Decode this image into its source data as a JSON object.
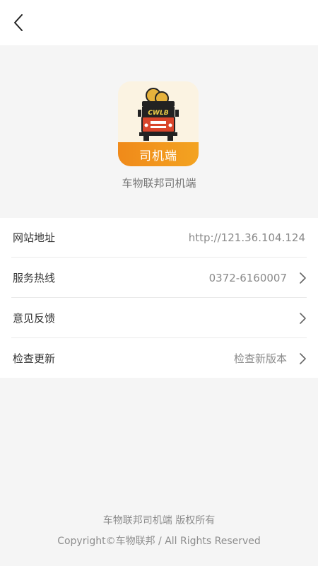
{
  "app": {
    "icon_label": "司机端",
    "icon_logo_text": "CWLB",
    "name": "车物联邦司机端"
  },
  "settings": [
    {
      "label": "网站地址",
      "value": "http://121.36.104.124"
    },
    {
      "label": "服务热线",
      "value": "0372-6160007"
    },
    {
      "label": "意见反馈",
      "value": ""
    },
    {
      "label": "检查更新",
      "value": "检查新版本"
    }
  ],
  "footer": {
    "line1": "车物联邦司机端 版权所有",
    "line2": "Copyright©车物联邦 / All Rights Reserved"
  },
  "colors": {
    "accent": "#f08a1a",
    "truck_red": "#d9452b",
    "coin_gold": "#e6b23c"
  },
  "icons": {
    "back": "chevron-left-icon",
    "row_arrow": "chevron-right-icon",
    "app_logo": "truck-logo-icon"
  }
}
